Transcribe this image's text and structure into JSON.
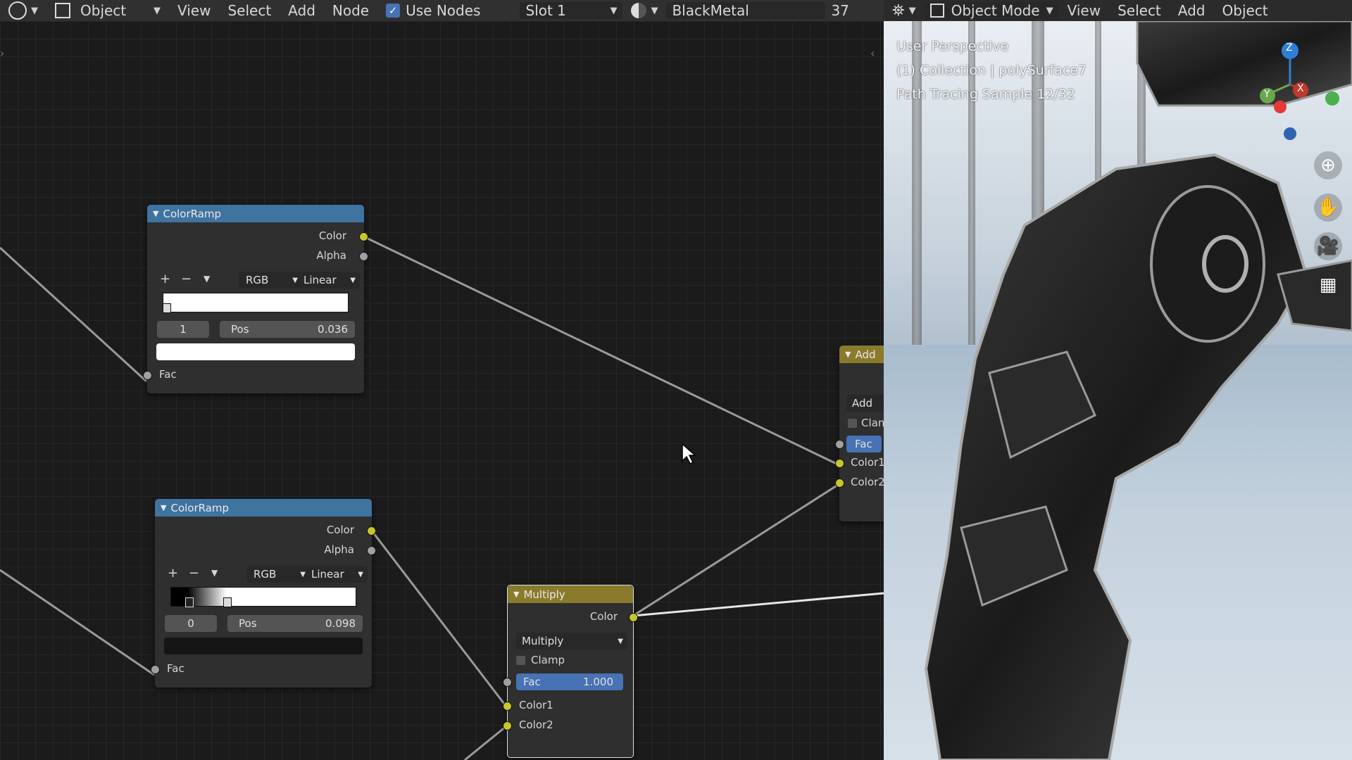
{
  "node_header": {
    "editor_type_icon": "shader-editor-icon",
    "object_menu": "Object",
    "menus": [
      "View",
      "Select",
      "Add",
      "Node"
    ],
    "use_nodes_label": "Use Nodes",
    "use_nodes_checked": true,
    "slot": "Slot 1",
    "material_name": "BlackMetal",
    "user_count": "37"
  },
  "viewport_header": {
    "mode": "Object Mode",
    "menus": [
      "View",
      "Select",
      "Add",
      "Object"
    ]
  },
  "viewport_overlay": {
    "line1": "User Perspective",
    "line2": "(1) Collection | polySurface7",
    "line3": "Path Tracing Sample 12/32"
  },
  "gizmo": {
    "z": "Z",
    "y": "Y",
    "x": "X"
  },
  "nodes": {
    "colorramp1": {
      "title": "ColorRamp",
      "out_color": "Color",
      "out_alpha": "Alpha",
      "add": "+",
      "remove": "−",
      "color_mode": "RGB",
      "interpolation": "Linear",
      "index": "1",
      "pos_label": "Pos",
      "pos_value": "0.036",
      "in_fac": "Fac"
    },
    "colorramp2": {
      "title": "ColorRamp",
      "out_color": "Color",
      "out_alpha": "Alpha",
      "add": "+",
      "remove": "−",
      "color_mode": "RGB",
      "interpolation": "Linear",
      "index": "0",
      "pos_label": "Pos",
      "pos_value": "0.098",
      "in_fac": "Fac"
    },
    "multiply": {
      "title": "Multiply",
      "out_color": "Color",
      "blend": "Multiply",
      "clamp": "Clamp",
      "fac_label": "Fac",
      "fac_value": "1.000",
      "in_color1": "Color1",
      "in_color2": "Color2"
    },
    "add": {
      "title": "Add",
      "blend": "Add",
      "clamp": "Clan",
      "fac_label": "Fac",
      "in_color1": "Color1",
      "in_color2": "Color2"
    }
  },
  "colors": {
    "colorramp_header": "#3f73a0",
    "mix_header": "#8a7a2c",
    "socket_color": "#c7c729",
    "socket_float": "#a0a0a0",
    "selected_field": "#4772b3"
  }
}
